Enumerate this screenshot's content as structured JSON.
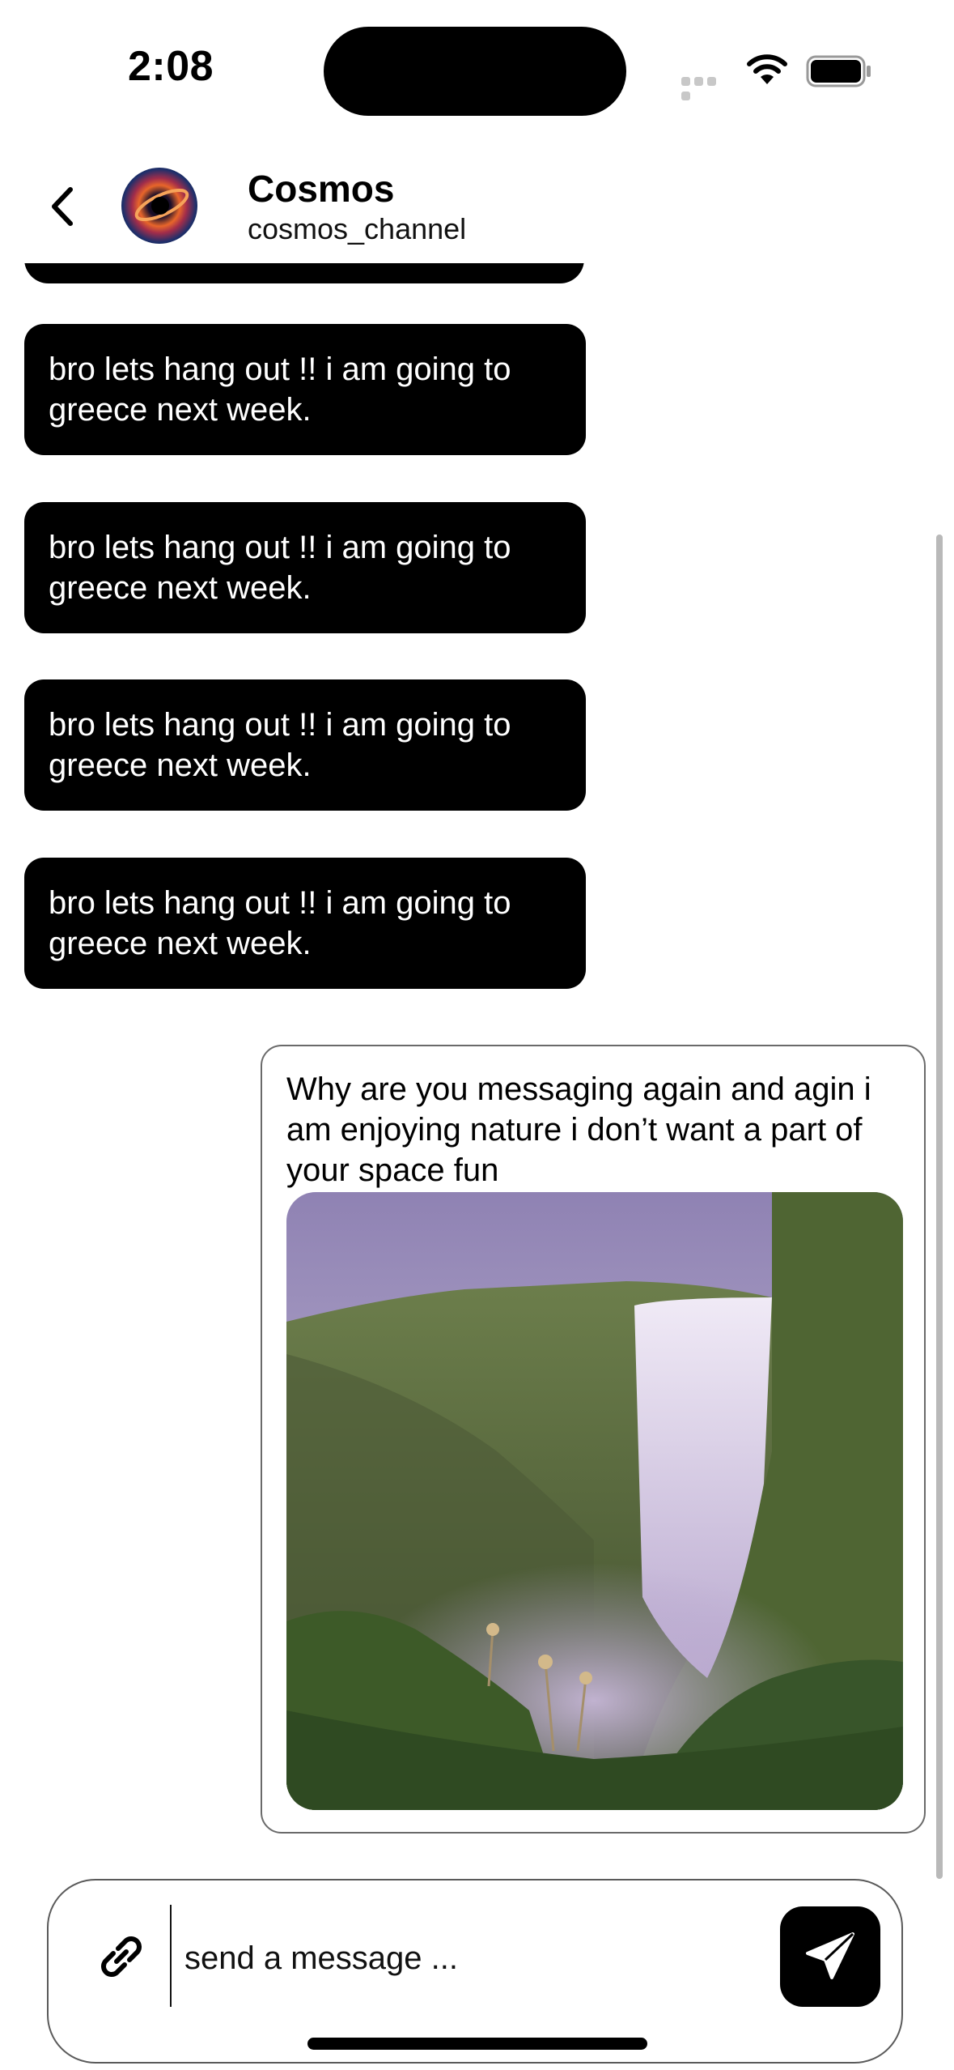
{
  "status_bar": {
    "time": "2:08",
    "icons": [
      "cellular-signal-icon",
      "wifi-icon",
      "battery-icon"
    ]
  },
  "header": {
    "back_icon": "chevron-left-icon",
    "channel_name": "Cosmos",
    "channel_handle": "cosmos_channel"
  },
  "messages": [
    {
      "direction": "incoming",
      "text": "bro lets hang out !! i am going to greece next week."
    },
    {
      "direction": "incoming",
      "text": "bro lets hang out !! i am going to greece next week."
    },
    {
      "direction": "incoming",
      "text": "bro lets hang out !! i am going to greece next week."
    },
    {
      "direction": "incoming",
      "text": "bro lets hang out !! i am going to greece next week."
    },
    {
      "direction": "outgoing",
      "text": "Why are you messaging again and agin i am enjoying nature i don’t want a part of your space fun",
      "attachment": "waterfall-photo"
    }
  ],
  "composer": {
    "attach_icon": "link-icon",
    "placeholder": "send a message ...",
    "value": "",
    "send_icon": "paper-plane-icon"
  },
  "colors": {
    "incoming_bubble": "#000000",
    "incoming_text": "#ffffff",
    "outgoing_border": "#6a6a6a",
    "background": "#ffffff"
  }
}
